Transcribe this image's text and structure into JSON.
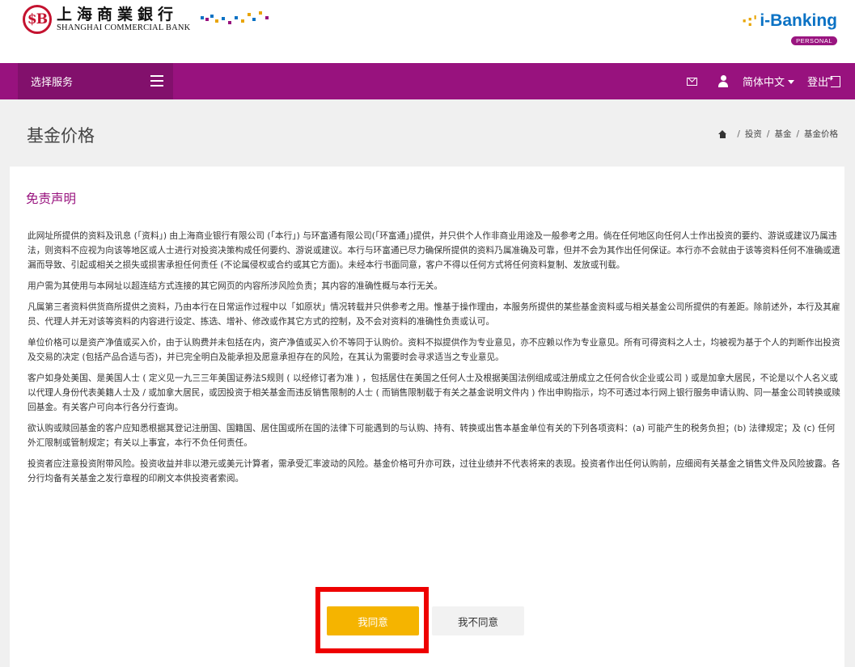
{
  "header": {
    "logo_seal": "$B",
    "logo_cn": "上海商業銀行",
    "logo_en": "SHANGHAI COMMERCIAL BANK",
    "ibanking_label": "i-Banking",
    "ibanking_badge": "PERSONAL",
    "brand_colors": {
      "primary": "#98127e",
      "accent": "#f5b400",
      "link": "#0b72c4",
      "seal": "#c4122f"
    }
  },
  "nav": {
    "service_label": "选择服务",
    "language": "简体中文",
    "logout": "登出",
    "icons": [
      "menu-icon",
      "mail-icon",
      "user-icon",
      "caret-down-icon",
      "logout-icon"
    ]
  },
  "page": {
    "title": "基金价格",
    "breadcrumb": [
      "投资",
      "基金",
      "基金价格"
    ]
  },
  "disclaimer": {
    "title": "免责声明",
    "paragraphs": [
      "此网址所提供的资料及讯息 (「资料」) 由上海商业银行有限公司 (「本行」) 与环富通有限公司(「环富通」)提供，并只供个人作非商业用途及一般参考之用。倘在任何地区向任何人士作出投资的要约、游说或建议乃属违法，则资料不应视为向该等地区或人士进行对投资决策构成任何要约、游说或建议。本行与环富通已尽力确保所提供的资料乃属准确及可靠，但并不会为其作出任何保证。本行亦不会就由于该等资料任何不准确或遗漏而导致、引起或相关之损失或损害承担任何责任 (不论属侵权或合约或其它方面)。未经本行书面同意，客户不得以任何方式将任何资料复制、发放或刊载。",
      "用户需为其使用与本网址以超连结方式连接的其它网页的内容所涉风险负责；其内容的准确性概与本行无关。",
      "凡属第三者资料供货商所提供之资料，乃由本行在日常运作过程中以「如原状」情况转载并只供参考之用。惟基于操作理由，本服务所提供的某些基金资料或与相关基金公司所提供的有差距。除前述外，本行及其雇员、代理人并无对该等资料的内容进行设定、拣选、增补、修改或作其它方式的控制，及不会对资料的准确性负责或认可。",
      "单位价格可以是资产净值或买入价，由于认购费并未包括在内，资产净值或买入价不等同于认购价。资料不拟提供作为专业意见，亦不应赖以作为专业意见。所有可得资料之人士，均被视为基于个人的判断作出投资及交易的决定 (包括产品合适与否)，并已完全明白及能承担及愿意承担存在的风险，在其认为需要时会寻求适当之专业意见。",
      "客户如身处美国、是美国人士 ( 定义见一九三三年美国证券法S规则 ( 以经修订者为准 ) ，包括居住在美国之任何人士及根据美国法例组成或注册成立之任何合伙企业或公司 ) 或是加拿大居民，不论是以个人名义或以代理人身份代表美籍人士及 / 或加拿大居民，或因投资于相关基金而违反销售限制的人士 ( 而销售限制载于有关之基金说明文件内 ) 作出申购指示，均不可透过本行网上银行服务申请认购、同一基金公司转换或赎回基金。有关客户可向本行各分行查询。",
      "欲认购或赎回基金的客户应知悉根据其登记注册国、国籍国、居住国或所在国的法律下可能遇到的与认购、持有、转换或出售本基金单位有关的下列各项资料：(a) 可能产生的税务负担；(b) 法律规定；及 (c) 任何外汇限制或管制规定；有关以上事宜，本行不负任何责任。",
      "投资者应注意投资附带风险。投资收益并非以港元或美元计算者，需承受汇率波动的风险。基金价格可升亦可跌，过往业绩并不代表将来的表现。投资者作出任何认购前，应细阅有关基金之销售文件及风险披露。各分行均备有关基金之发行章程的印刷文本供投资者索阅。"
    ]
  },
  "buttons": {
    "agree": "我同意",
    "disagree": "我不同意"
  }
}
